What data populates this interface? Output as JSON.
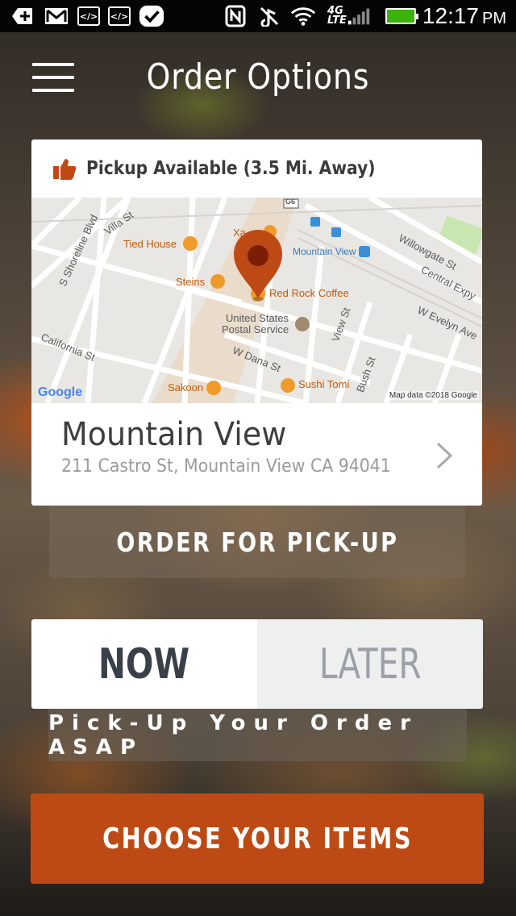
{
  "status_bar": {
    "time": "12:17",
    "ampm": "PM",
    "network": "4G",
    "network_sub": "LTE",
    "icons": [
      "add-icon",
      "gmail-icon",
      "code-icon",
      "code-icon",
      "check-icon",
      "nfc-icon",
      "mute-icon",
      "wifi-icon",
      "signal-icon",
      "battery-charging-icon"
    ]
  },
  "header": {
    "title": "Order Options"
  },
  "pickup": {
    "availability": "Pickup Available (3.5 Mi. Away)"
  },
  "map": {
    "highway_marker": "G6",
    "labels": {
      "villa_st": "Villa St",
      "shoreline": "S Shoreline Blvd",
      "tied_house": "Tied House",
      "steins": "Steins",
      "xa": "Xa",
      "mountain_view": "Mountain View",
      "willowgate": "Willowgate St",
      "central_expy": "Central Expy",
      "red_rock": "Red Rock Coffee",
      "post_office_1": "United States",
      "post_office_2": "Postal Service",
      "view_st": "View St",
      "w_evelyn": "W Evelyn Ave",
      "california": "California St",
      "w_dana": "W Dana St",
      "bush_st": "Bush St",
      "sakoon": "Sakoon",
      "sushi_tomi": "Sushi Tomi"
    },
    "google_logo": "Google",
    "attribution": "Map data ©2018 Google"
  },
  "location": {
    "name": "Mountain View",
    "address": "211 Castro St, Mountain View CA 94041"
  },
  "order_type_label": "ORDER FOR PICK-UP",
  "timing": {
    "now": "NOW",
    "later": "LATER",
    "selected": "NOW"
  },
  "timing_note": "Pick-Up Your Order ASAP",
  "cta": "CHOOSE YOUR ITEMS",
  "colors": {
    "accent": "#bd4a15",
    "pin": "#bd4a15"
  }
}
